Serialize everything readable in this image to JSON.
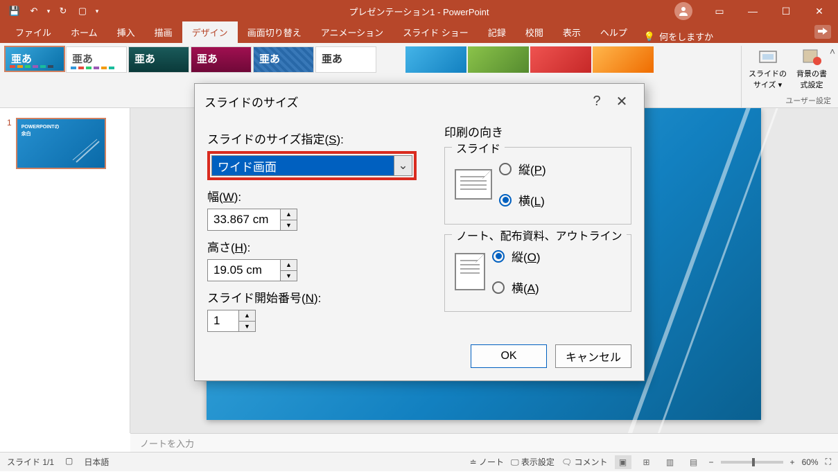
{
  "title": "プレゼンテーション1 - PowerPoint",
  "tabs": {
    "file": "ファイル",
    "home": "ホーム",
    "insert": "挿入",
    "draw": "描画",
    "design": "デザイン",
    "transitions": "画面切り替え",
    "animations": "アニメーション",
    "slideshow": "スライド ショー",
    "record": "記録",
    "review": "校閲",
    "view": "表示",
    "help": "ヘルプ"
  },
  "tellme": "何をしますか",
  "themes": {
    "sample": "亜あ"
  },
  "customize": {
    "size": "スライドの\nサイズ ▾",
    "bg": "背景の書\n式設定",
    "group": "ユーザー設定"
  },
  "slidelist": {
    "num": "1",
    "thumb_title": "POWERPOINTの\n余白"
  },
  "notes_placeholder": "ノートを入力",
  "status": {
    "slide": "スライド 1/1",
    "lang": "日本語",
    "notes": "ノート",
    "display": "表示設定",
    "comments": "コメント",
    "zoom": "60%"
  },
  "dialog": {
    "title": "スライドのサイズ",
    "size_label": "スライドのサイズ指定(",
    "size_key": "S",
    "size_value": "ワイド画面",
    "width_label": "幅(",
    "width_key": "W",
    "width_value": "33.867 cm",
    "height_label": "高さ(",
    "height_key": "H",
    "height_value": "19.05 cm",
    "start_label": "スライド開始番号(",
    "start_key": "N",
    "start_value": "1",
    "orient_title": "印刷の向き",
    "g1": "スライド",
    "g2": "ノート、配布資料、アウトライン",
    "portrait": "縦(",
    "portrait_key": "P",
    "landscape": "横(",
    "landscape_key": "L",
    "portrait2": "縦(",
    "portrait2_key": "O",
    "landscape2": "横(",
    "landscape2_key": "A",
    "close": ")：",
    "ok": "OK",
    "cancel": "キャンセル"
  }
}
